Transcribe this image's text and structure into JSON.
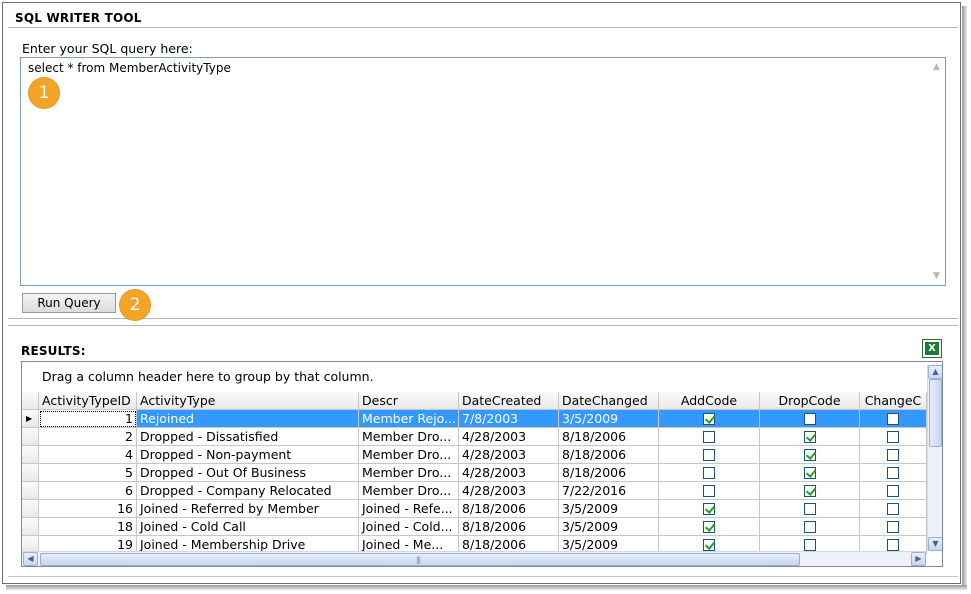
{
  "app": {
    "title": "SQL WRITER TOOL"
  },
  "editor": {
    "prompt": "Enter your SQL query here:",
    "query": "select * from MemberActivityType",
    "run_label": "Run Query"
  },
  "callouts": {
    "one": "1",
    "two": "2"
  },
  "results": {
    "title": "RESULTS:",
    "export_icon": "excel-icon",
    "group_hint": "Drag a column header here to group by that column.",
    "columns": [
      "ActivityTypeID",
      "ActivityType",
      "Descr",
      "DateCreated",
      "DateChanged",
      "AddCode",
      "DropCode",
      "ChangeC"
    ],
    "rows": [
      {
        "id": "1",
        "type": "Rejoined",
        "descr": "Member Rejo...",
        "created": "7/8/2003",
        "changed": "3/5/2009",
        "add": true,
        "drop": false,
        "change": false
      },
      {
        "id": "2",
        "type": "Dropped - Dissatisfied",
        "descr": "Member Dro...",
        "created": "4/28/2003",
        "changed": "8/18/2006",
        "add": false,
        "drop": true,
        "change": false
      },
      {
        "id": "4",
        "type": "Dropped - Non-payment",
        "descr": "Member Dro...",
        "created": "4/28/2003",
        "changed": "8/18/2006",
        "add": false,
        "drop": true,
        "change": false
      },
      {
        "id": "5",
        "type": "Dropped - Out Of Business",
        "descr": "Member Dro...",
        "created": "4/28/2003",
        "changed": "8/18/2006",
        "add": false,
        "drop": true,
        "change": false
      },
      {
        "id": "6",
        "type": "Dropped - Company Relocated",
        "descr": "Member Dro...",
        "created": "4/28/2003",
        "changed": "7/22/2016",
        "add": false,
        "drop": true,
        "change": false
      },
      {
        "id": "16",
        "type": "Joined - Referred by Member",
        "descr": "Joined - Refe...",
        "created": "8/18/2006",
        "changed": "3/5/2009",
        "add": true,
        "drop": false,
        "change": false
      },
      {
        "id": "18",
        "type": "Joined - Cold Call",
        "descr": "Joined - Cold...",
        "created": "8/18/2006",
        "changed": "3/5/2009",
        "add": true,
        "drop": false,
        "change": false
      },
      {
        "id": "19",
        "type": "Joined - Membership Drive",
        "descr": "Joined - Me...",
        "created": "8/18/2006",
        "changed": "3/5/2009",
        "add": true,
        "drop": false,
        "change": false
      }
    ],
    "selected_row": 0
  },
  "colors": {
    "accent_badge": "#f3a52a",
    "selection": "#3399ff",
    "excel_green": "#1e7b34"
  }
}
